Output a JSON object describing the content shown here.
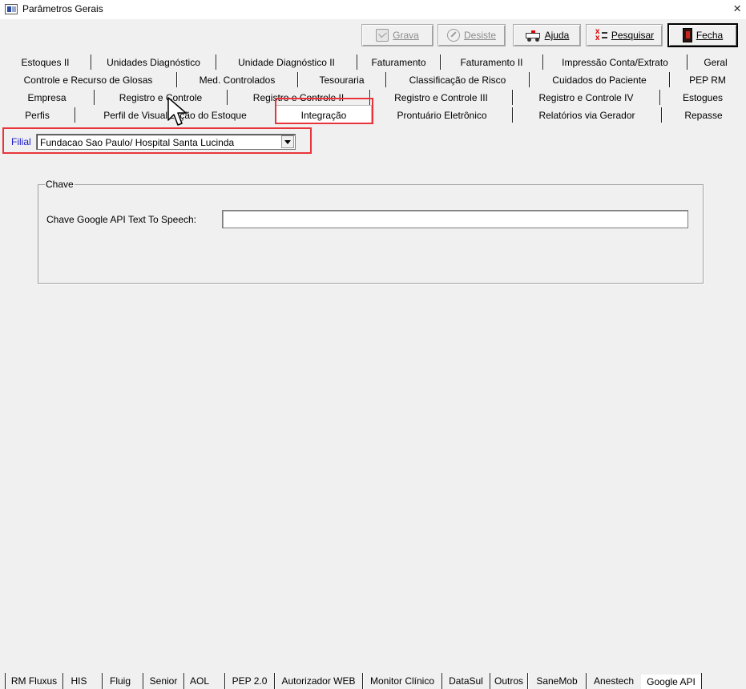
{
  "window": {
    "title": "Parâmetros Gerais",
    "close_glyph": "×"
  },
  "toolbar": {
    "grava": "Grava",
    "desiste": "Desiste",
    "ajuda": "Ajuda",
    "pesquisar": "Pesquisar",
    "fecha": "Fecha"
  },
  "tabs": {
    "row1": [
      "Estoques II",
      "Unidades Diagnóstico",
      "Unidade Diagnóstico II",
      "Faturamento",
      "Faturamento II",
      "Impressão Conta/Extrato",
      "Geral"
    ],
    "row2": [
      "Controle e Recurso de Glosas",
      "Med. Controlados",
      "Tesouraria",
      "Classificação de Risco",
      "Cuidados do Paciente",
      "PEP RM"
    ],
    "row3": [
      "Empresa",
      "Registro e Controle",
      "Registro e Controle II",
      "Registro e Controle III",
      "Registro e Controle IV",
      "Estogues"
    ],
    "row4": [
      "Perfis",
      "Perfil de Visualização do Estoque",
      "Integração",
      "Prontuário Eletrônico",
      "Relatórios via Gerador",
      "Repasse"
    ],
    "selected": "Integração"
  },
  "filial": {
    "label": "Filial",
    "value": "Fundacao Sao Paulo/ Hospital Santa Lucinda"
  },
  "chave_group": {
    "legend": "Chave",
    "field_label": "Chave Google API Text To Speech:",
    "field_value": ""
  },
  "bottom_tabs": {
    "items": [
      "RM Fluxus",
      "HIS",
      "Fluig",
      "Senior",
      "AOL",
      "PEP 2.0",
      "Autorizador WEB",
      "Monitor Clínico",
      "DataSul",
      "Outros",
      "SaneMob",
      "Anestech",
      "Google API"
    ],
    "selected": "Google API"
  },
  "colors": {
    "highlight": "#e8353b",
    "filial_label": "#1c1ccc",
    "background": "#f0f0f0"
  }
}
